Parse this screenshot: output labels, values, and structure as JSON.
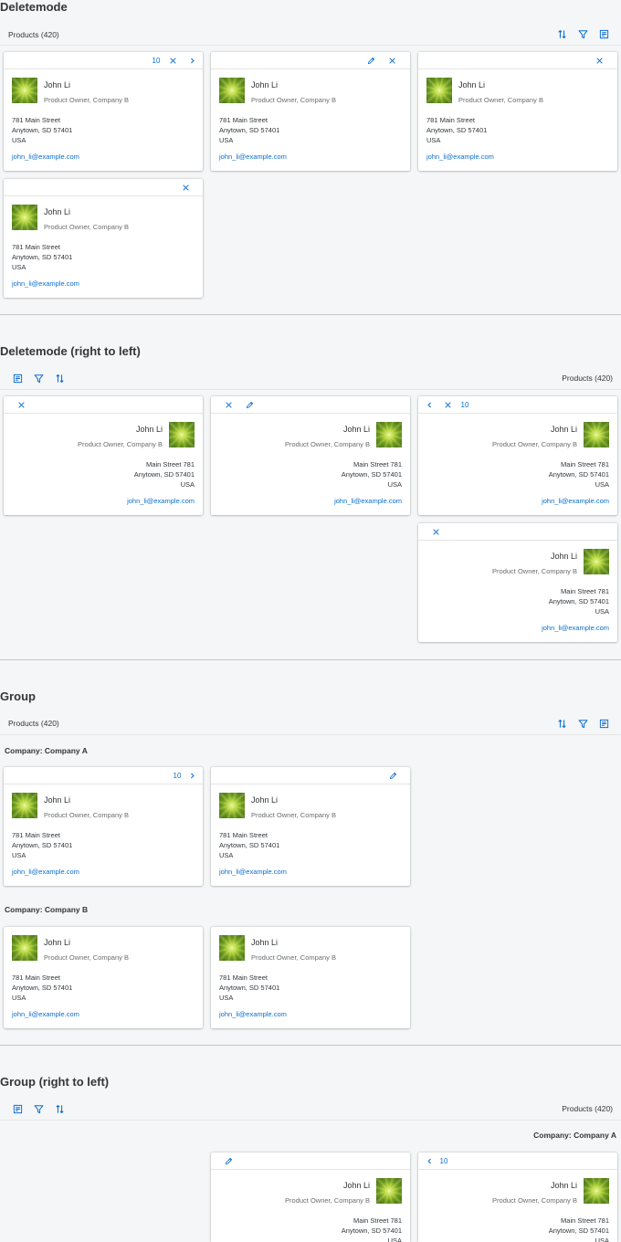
{
  "sections": {
    "deletemode": {
      "title": "Deletemode",
      "products": "Products (420)"
    },
    "deletemode_rtl": {
      "title": "Deletemode (right to left)",
      "products": "Products (420)"
    },
    "group": {
      "title": "Group",
      "products": "Products (420)",
      "group_a": "Company: Company A",
      "group_b": "Company: Company B"
    },
    "group_rtl": {
      "title": "Group (right to left)",
      "products": "Products (420)",
      "group_a": "Company: Company A"
    }
  },
  "card": {
    "name": "John Li",
    "role": "Product Owner, Company B",
    "address_ltr": [
      "781 Main Street",
      "Anytown, SD 57401",
      "USA"
    ],
    "address_rtl": [
      "Main Street 781",
      "Anytown, SD 57401",
      "USA"
    ],
    "email": "john_li@example.com"
  },
  "counter": "10",
  "icons": {
    "sort": "sort-icon",
    "filter": "filter-icon",
    "settings": "table-settings-icon",
    "close": "close-icon",
    "edit": "edit-icon",
    "next": "chevron-right-icon",
    "prev": "chevron-left-icon"
  },
  "colors": {
    "accent": "#0a6ed1",
    "background": "#f5f6f7",
    "text": "#32363a"
  }
}
